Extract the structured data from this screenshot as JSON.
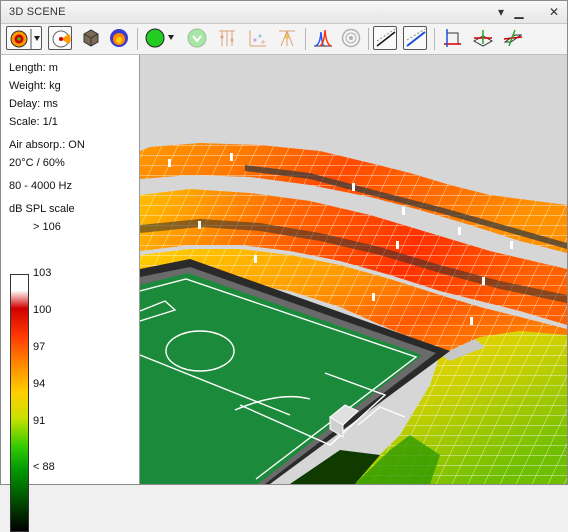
{
  "window": {
    "title": "3D SCENE",
    "controls": {
      "pin": "▾",
      "minimize": "▁",
      "close": "✕"
    }
  },
  "toolbar": {
    "icons": [
      "spl-map-icon",
      "dropdown-arrow",
      "source-view-icon",
      "room-model-icon",
      "directivity-icon",
      "receiver-green-icon",
      "dropdown-arrow",
      "receiver-faded-icon",
      "grid-points-icon",
      "axes-chart-icon",
      "spread-icon",
      "spectrum-icon",
      "target-icon",
      "line-view-icon",
      "line-view-blue-icon",
      "plane-xy-icon",
      "plane-xz-icon",
      "plane-yz-icon"
    ]
  },
  "sidebar": {
    "units": {
      "length": "Length: m",
      "weight": "Weight: kg",
      "delay": "Delay: ms",
      "scale": "Scale: 1/1"
    },
    "conditions": {
      "air": "Air absorp.: ON",
      "climate": "20°C / 60%",
      "band": "80 - 4000 Hz"
    },
    "scale_title": "dB SPL scale",
    "scale_ticks": [
      "> 106",
      "103",
      "100",
      "97",
      "94",
      "91",
      "< 88"
    ]
  },
  "colors": {
    "hot": "#e82000",
    "warm": "#ff9a00",
    "mid": "#ffd200",
    "cool": "#7fc800",
    "pitch": "#1b8a3a"
  }
}
